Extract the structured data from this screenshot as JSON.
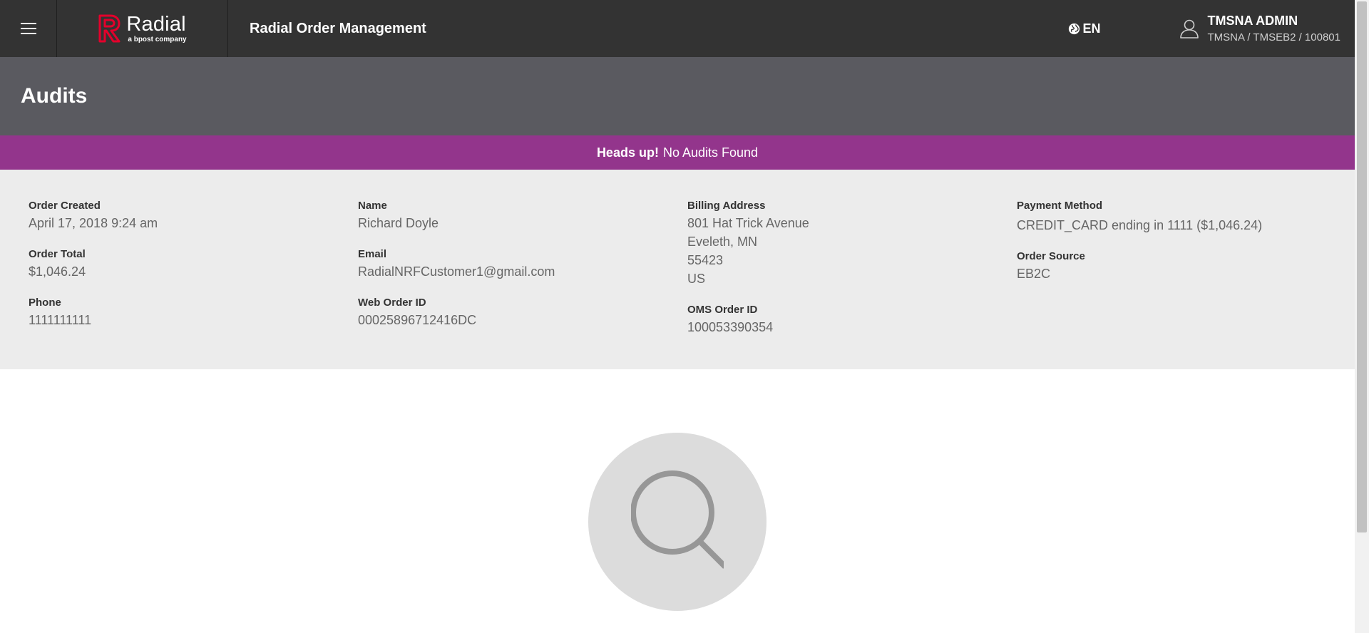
{
  "header": {
    "brand": "Radial",
    "brand_sub": "a bpost company",
    "app_title": "Radial Order Management",
    "language": "EN",
    "user_name": "TMSNA ADMIN",
    "user_org": "TMSNA / TMSEB2 / 100801"
  },
  "page": {
    "title": "Audits"
  },
  "alert": {
    "strong": "Heads up!",
    "message": "No Audits Found"
  },
  "order": {
    "created_label": "Order Created",
    "created_value": "April 17, 2018 9:24 am",
    "total_label": "Order Total",
    "total_value": "$1,046.24",
    "phone_label": "Phone",
    "phone_value": "1111111111",
    "name_label": "Name",
    "name_value": "Richard Doyle",
    "email_label": "Email",
    "email_value": "RadialNRFCustomer1@gmail.com",
    "web_order_label": "Web Order ID",
    "web_order_value": "00025896712416DC",
    "billing_label": "Billing Address",
    "billing_lines": [
      "801 Hat Trick Avenue",
      "Eveleth, MN",
      "55423",
      "US"
    ],
    "oms_label": "OMS Order ID",
    "oms_value": "100053390354",
    "payment_label": "Payment Method",
    "payment_value": "CREDIT_CARD ending in 1111 ($1,046.24)",
    "source_label": "Order Source",
    "source_value": "EB2C"
  },
  "icons": {
    "menu": "hamburger-menu-icon",
    "language": "globe-icon",
    "user": "user-icon",
    "empty": "search-icon"
  },
  "colors": {
    "topbar": "#333333",
    "page_header": "#5a5a60",
    "alert": "#93358c",
    "details_bg": "#ececec",
    "brand_red": "#e4002b"
  }
}
